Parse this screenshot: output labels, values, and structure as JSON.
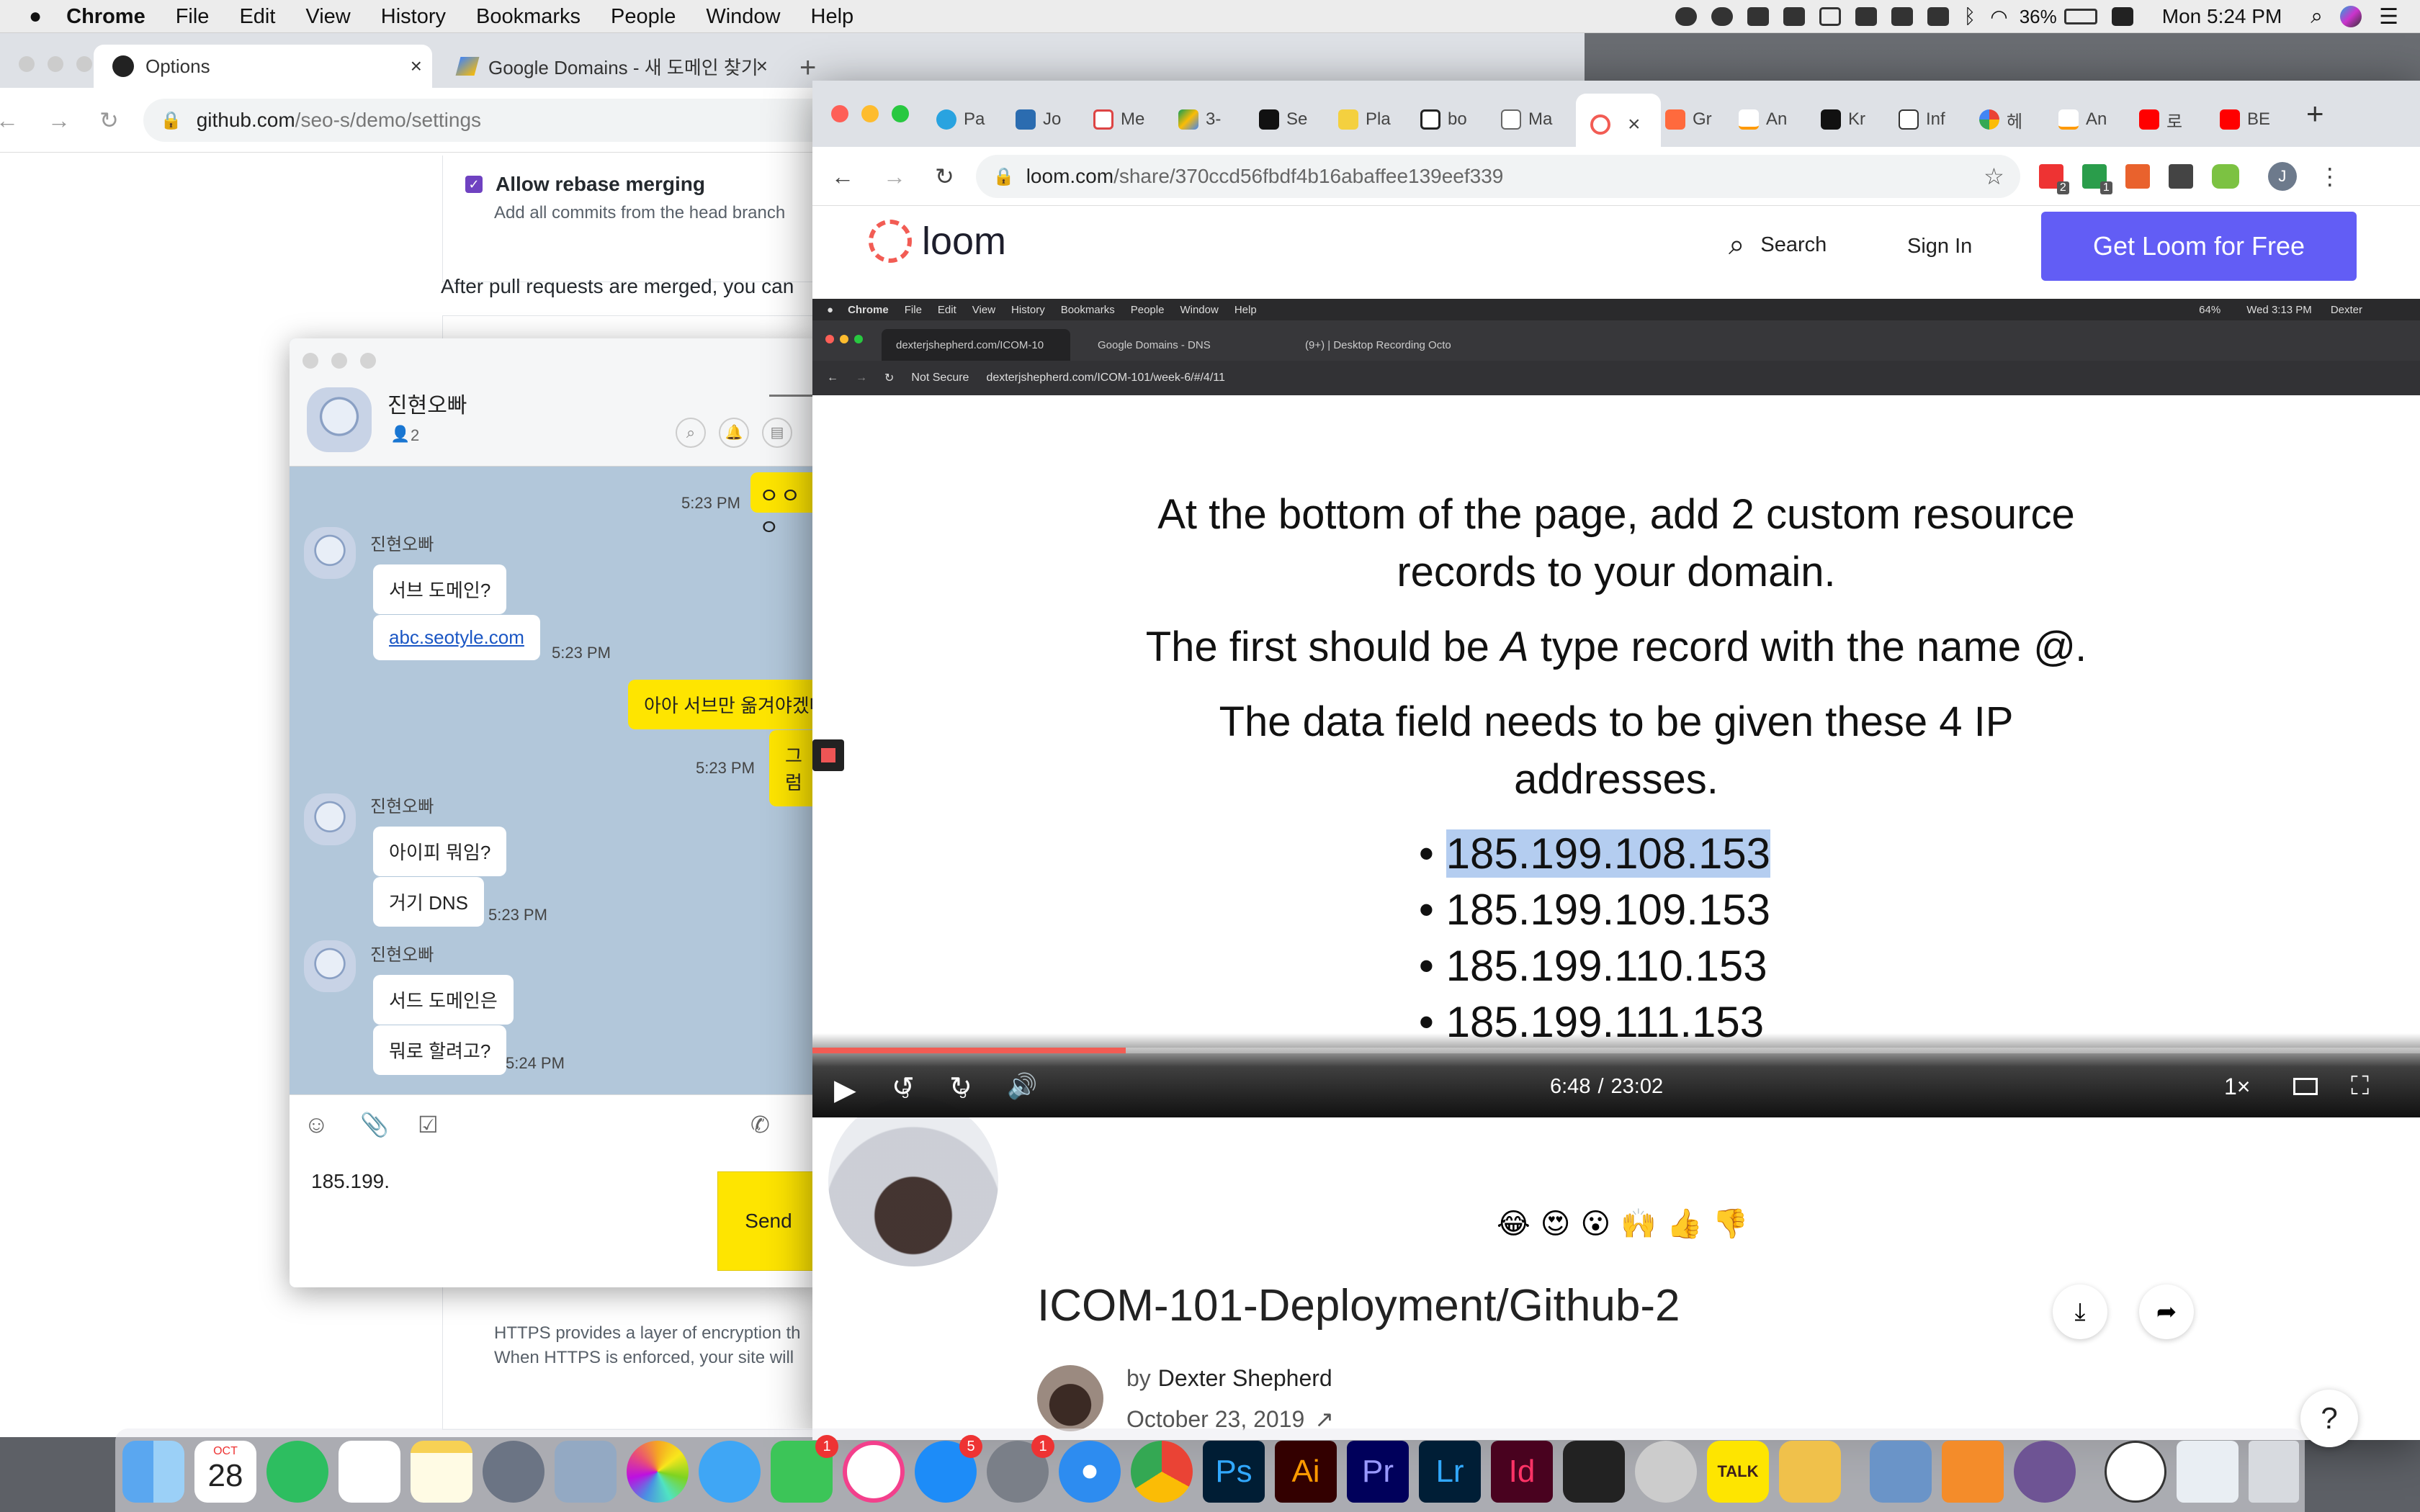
{
  "menubar": {
    "app": "Chrome",
    "items": [
      "File",
      "Edit",
      "View",
      "History",
      "Bookmarks",
      "People",
      "Window",
      "Help"
    ],
    "battery": "36%",
    "clock": "Mon 5:24 PM"
  },
  "left_chrome": {
    "tabs": [
      {
        "label": "Options",
        "icon": "github-icon"
      },
      {
        "label": "Google Domains - 새 도메인 찾기",
        "icon": "google-domains-icon"
      }
    ],
    "url_domain": "github.com",
    "url_path": "/seo-s/demo/settings",
    "rebase_label": "Allow rebase merging",
    "rebase_desc": "Add all commits from the head branch",
    "after_merge": "After pull requests are merged, you can",
    "https_line1": "HTTPS provides a layer of encryption th",
    "https_line2": "When HTTPS is enforced, your site will"
  },
  "kakao": {
    "room_name": "진현오빠",
    "member_count": "2",
    "messages": [
      {
        "type": "time",
        "text": "5:23 PM"
      },
      {
        "type": "name",
        "text": "진현오빠"
      },
      {
        "type": "in",
        "text": "서브 도메인?"
      },
      {
        "type": "link",
        "text": "abc.seotyle.com"
      },
      {
        "type": "time",
        "text": "5:23 PM"
      },
      {
        "type": "out",
        "text": "아아 서브만 옮겨야겠따"
      },
      {
        "type": "out",
        "text": "그럼"
      },
      {
        "type": "time",
        "text": "5:23 PM"
      },
      {
        "type": "name",
        "text": "진현오빠"
      },
      {
        "type": "in",
        "text": "아이피 뭐임?"
      },
      {
        "type": "in",
        "text": "거기 DNS"
      },
      {
        "type": "time",
        "text": "5:23 PM"
      },
      {
        "type": "name",
        "text": "진현오빠"
      },
      {
        "type": "in",
        "text": "서드 도메인은"
      },
      {
        "type": "in",
        "text": "뭐로 할려고?"
      },
      {
        "type": "time",
        "text": "5:24 PM"
      }
    ],
    "input_value": "185.199.",
    "send_label": "Send"
  },
  "loom_window": {
    "tabs": [
      "Pa",
      "Jo",
      "Me",
      "3-",
      "Se",
      "Pla",
      "bo",
      "Ma",
      "",
      "Gr",
      "An",
      "Kr",
      "Inf",
      "헤",
      "An",
      "로",
      "BE"
    ],
    "url_domain": "loom.com",
    "url_path": "/share/370ccd56fbdf4b16abaffee139eef339",
    "ext_badges": [
      "2",
      "1"
    ],
    "profile_initial": "J"
  },
  "loom": {
    "logo_text": "loom",
    "search_label": "Search",
    "signin_label": "Sign In",
    "cta_label": "Get Loom for Free",
    "video": {
      "inner_menubar": {
        "app": "Chrome",
        "items": [
          "File",
          "Edit",
          "View",
          "History",
          "Bookmarks",
          "People",
          "Window",
          "Help"
        ],
        "battery": "64%",
        "clock": "Wed 3:13 PM",
        "user": "Dexter"
      },
      "inner_tabs": [
        "dexterjshepherd.com/ICOM-10",
        "Google Domains - DNS",
        "(9+) | Desktop Recording Octo"
      ],
      "inner_url_security": "Not Secure",
      "inner_url": "dexterjshepherd.com/ICOM-101/week-6/#/4/11",
      "slide_p1": "At the bottom of the page, add 2 custom resource records to your domain.",
      "slide_p2_a": "The first should be ",
      "slide_p2_b": "A",
      "slide_p2_c": " type record with the name ",
      "slide_p2_d": "@",
      "slide_p2_e": ".",
      "slide_p3": "The data field needs to be given these 4 IP addresses.",
      "ips": [
        "185.199.108.153",
        "185.199.109.153",
        "185.199.110.153",
        "185.199.111.153"
      ],
      "progress": 0.195,
      "time_current": "6:48",
      "time_total": "23:02",
      "speed": "1×",
      "skip_back": "5",
      "skip_fwd": "5"
    },
    "reactions": [
      "😂",
      "😍",
      "😮",
      "🙌",
      "👍",
      "👎"
    ],
    "video_title": "ICOM-101-Deployment/Github-2",
    "by_label": "by",
    "author": "Dexter Shepherd",
    "date": "October 23, 2019",
    "help_label": "?"
  },
  "dock": {
    "apps": [
      "Finder",
      "Calendar",
      "Evernote",
      "Reminders",
      "Notes",
      "Launchpad",
      "Preview",
      "Photos",
      "Messages",
      "FaceTime",
      "iTunes",
      "App Store",
      "System Preferences",
      "Safari",
      "Chrome",
      "Photoshop",
      "Illustrator",
      "Premiere",
      "Lightroom",
      "InDesign",
      "Final Cut",
      "Compressor",
      "KakaoTalk",
      "Slack",
      "Image Capture",
      "Fusion 360",
      "GitHub",
      "Screen Recorder",
      "Folder",
      "Trash"
    ],
    "calendar_month": "OCT",
    "calendar_day": "28",
    "badges": {
      "FaceTime": "1",
      "App Store": "5",
      "System Preferences": "1"
    },
    "kakao_label": "TALK"
  }
}
